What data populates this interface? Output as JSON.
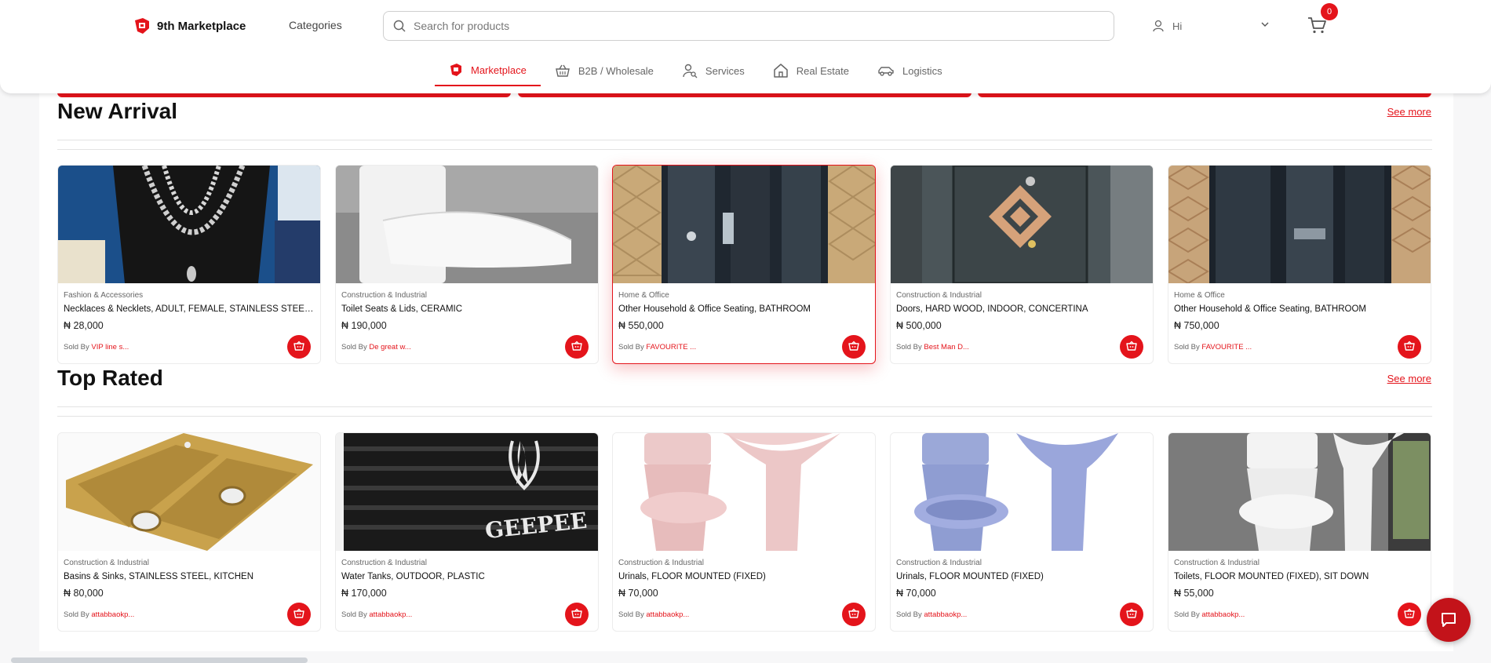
{
  "brand": {
    "name": "9th Marketplace",
    "accent": "#e4141b"
  },
  "header": {
    "categories_label": "Categories",
    "search_placeholder": "Search for products",
    "user_greeting": "Hi",
    "cart_count": "0"
  },
  "nav": [
    {
      "label": "Marketplace",
      "icon": "store-icon",
      "active": true
    },
    {
      "label": "B2B / Wholesale",
      "icon": "basket-icon",
      "active": false
    },
    {
      "label": "Services",
      "icon": "user-search-icon",
      "active": false
    },
    {
      "label": "Real Estate",
      "icon": "house-icon",
      "active": false
    },
    {
      "label": "Logistics",
      "icon": "car-icon",
      "active": false
    }
  ],
  "sections": [
    {
      "title": "New Arrival",
      "see_more": "See more",
      "products": [
        {
          "category": "Fashion & Accessories",
          "name": "Necklaces & Necklets, ADULT, FEMALE, STAINLESS STEEL, NO O...",
          "price": "₦ 28,000",
          "sold_by_label": "Sold By",
          "seller": "VIP line s...",
          "image": "necklace"
        },
        {
          "category": "Construction & Industrial",
          "name": "Toilet Seats & Lids, CERAMIC",
          "price": "₦ 190,000",
          "sold_by_label": "Sold By",
          "seller": "De great w...",
          "image": "toilet-seat"
        },
        {
          "category": "Home & Office",
          "name": "Other Household & Office Seating, BATHROOM",
          "price": "₦ 550,000",
          "sold_by_label": "Sold By",
          "seller": "FAVOURITE ...",
          "image": "shower-cabin"
        },
        {
          "category": "Construction & Industrial",
          "name": "Doors, HARD WOOD, INDOOR, CONCERTINA",
          "price": "₦ 500,000",
          "sold_by_label": "Sold By",
          "seller": "Best Man D...",
          "image": "door"
        },
        {
          "category": "Home & Office",
          "name": "Other Household & Office Seating, BATHROOM",
          "price": "₦ 750,000",
          "sold_by_label": "Sold By",
          "seller": "FAVOURITE ...",
          "image": "shower-cabin-2"
        }
      ]
    },
    {
      "title": "Top Rated",
      "see_more": "See more",
      "products": [
        {
          "category": "Construction & Industrial",
          "name": "Basins & Sinks, STAINLESS STEEL, KITCHEN",
          "price": "₦ 80,000",
          "sold_by_label": "Sold By",
          "seller": "attabbaokp...",
          "image": "gold-sink"
        },
        {
          "category": "Construction & Industrial",
          "name": "Water Tanks, OUTDOOR, PLASTIC",
          "price": "₦ 170,000",
          "sold_by_label": "Sold By",
          "seller": "attabbaokp...",
          "image": "water-tank"
        },
        {
          "category": "Construction & Industrial",
          "name": "Urinals, FLOOR MOUNTED (FIXED)",
          "price": "₦ 70,000",
          "sold_by_label": "Sold By",
          "seller": "attabbaokp...",
          "image": "pink-toilet"
        },
        {
          "category": "Construction & Industrial",
          "name": "Urinals, FLOOR MOUNTED (FIXED)",
          "price": "₦ 70,000",
          "sold_by_label": "Sold By",
          "seller": "attabbaokp...",
          "image": "blue-toilet"
        },
        {
          "category": "Construction & Industrial",
          "name": "Toilets, FLOOR MOUNTED (FIXED), SIT DOWN",
          "price": "₦ 55,000",
          "sold_by_label": "Sold By",
          "seller": "attabbaokp...",
          "image": "white-toilet"
        }
      ]
    }
  ],
  "tank_brand_text": "GEEPEE"
}
